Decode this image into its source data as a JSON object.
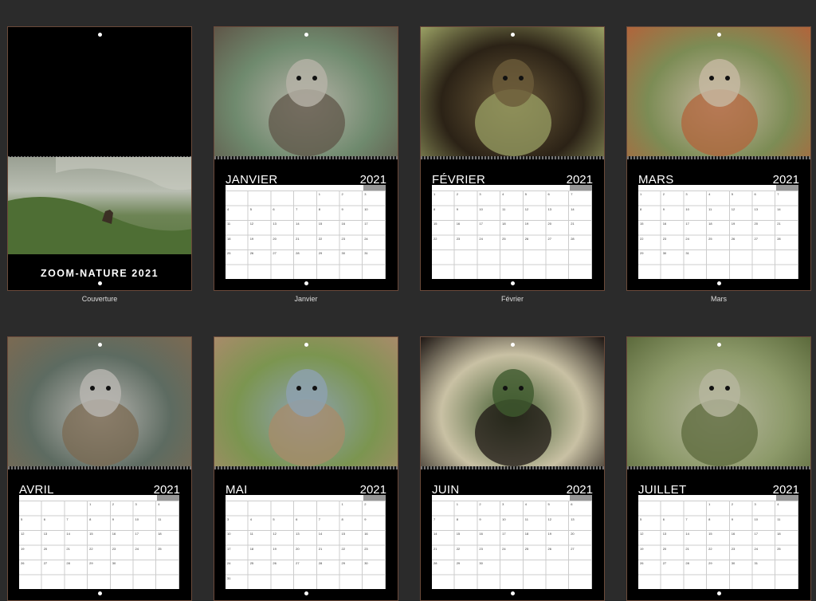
{
  "cover": {
    "title": "ZOOM-NATURE  2021",
    "caption": "Couverture"
  },
  "months": [
    {
      "name": "JANVIER",
      "year": "2021",
      "caption": "Janvier",
      "photo_icon": "ibex-photo",
      "colors": [
        "#6f8a6e",
        "#b7b3a8",
        "#5f5648"
      ]
    },
    {
      "name": "FÉVRIER",
      "year": "2021",
      "caption": "Février",
      "photo_icon": "frog-photo",
      "colors": [
        "#2b2216",
        "#6c5b3a",
        "#9aa064"
      ]
    },
    {
      "name": "MARS",
      "year": "2021",
      "caption": "Mars",
      "photo_icon": "fox-photo",
      "colors": [
        "#7c8c55",
        "#c7b9a3",
        "#b1643b"
      ]
    },
    {
      "name": "AVRIL",
      "year": "2021",
      "caption": "",
      "photo_icon": "marmot-photo",
      "colors": [
        "#5d6b61",
        "#b9b7b2",
        "#7b6a52"
      ]
    },
    {
      "name": "MAI",
      "year": "2021",
      "caption": "",
      "photo_icon": "chamois-photo",
      "colors": [
        "#7b9550",
        "#8da1b0",
        "#a88b6a"
      ]
    },
    {
      "name": "JUIN",
      "year": "2021",
      "caption": "",
      "photo_icon": "squirrel-photo",
      "colors": [
        "#c9c1a4",
        "#3f5a2e",
        "#1e1714"
      ]
    },
    {
      "name": "JUILLET",
      "year": "2021",
      "caption": "",
      "photo_icon": "bird-photo",
      "colors": [
        "#8d9a6a",
        "#b7b79f",
        "#5c6a3c"
      ]
    }
  ]
}
